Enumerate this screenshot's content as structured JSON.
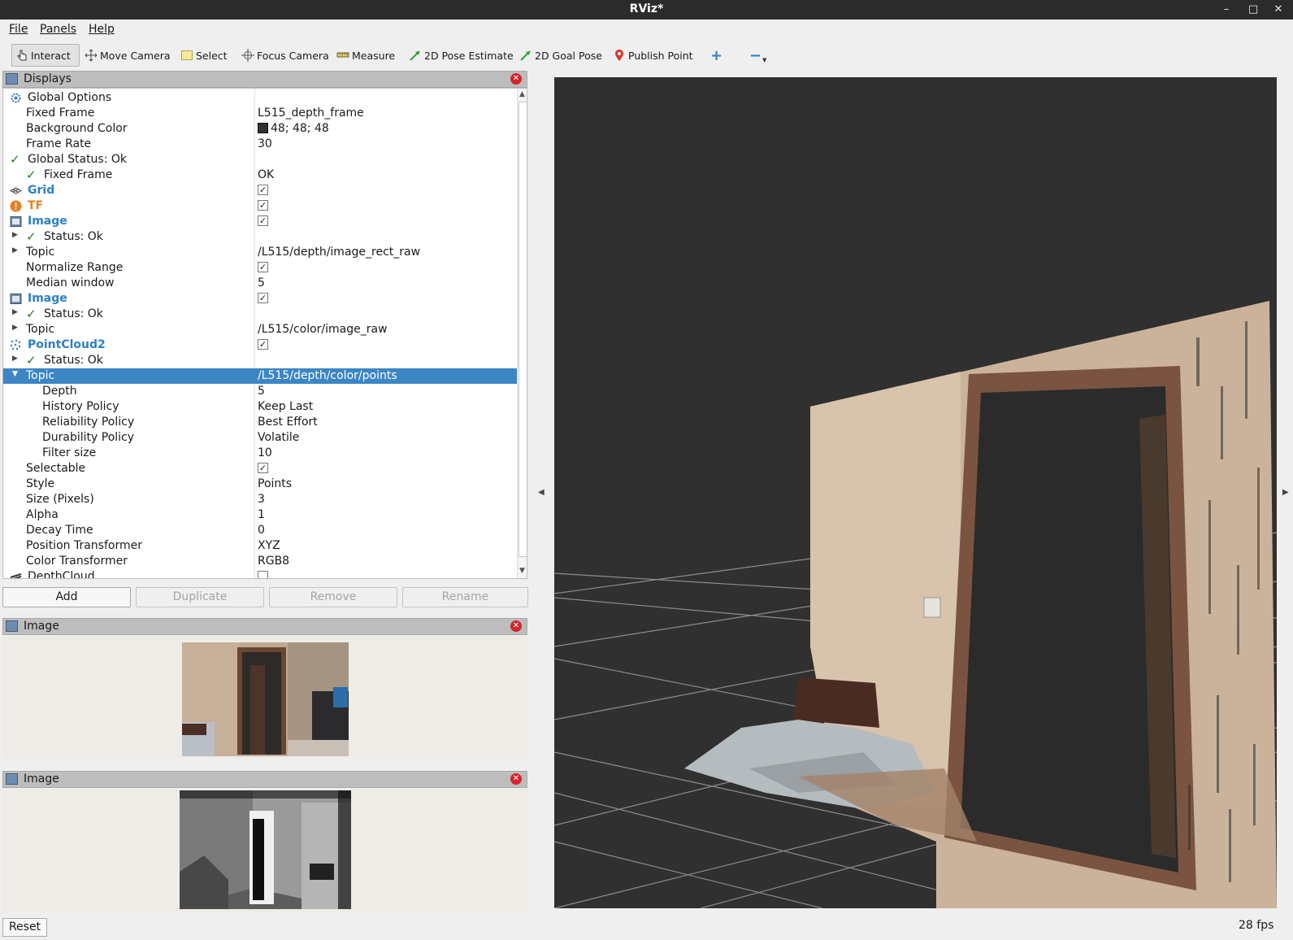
{
  "window": {
    "title": "RViz*",
    "controls": [
      "–",
      "□",
      "✕"
    ]
  },
  "menu": [
    "File",
    "Panels",
    "Help"
  ],
  "toolbar": {
    "interact": "Interact",
    "move_camera": "Move Camera",
    "select": "Select",
    "focus_camera": "Focus Camera",
    "measure": "Measure",
    "pose_estimate": "2D Pose Estimate",
    "goal_pose": "2D Goal Pose",
    "publish_point": "Publish Point",
    "add_tool": "+",
    "remove_tool": "−"
  },
  "displays": {
    "title": "Displays",
    "close": "✕",
    "rows": [
      {
        "label": "Global Options",
        "value": ""
      },
      {
        "label": "Fixed Frame",
        "value": "L515_depth_frame"
      },
      {
        "label": "Background Color",
        "value": "48; 48; 48"
      },
      {
        "label": "Frame Rate",
        "value": "30"
      },
      {
        "label": "Global Status: Ok",
        "value": ""
      },
      {
        "label": "Fixed Frame",
        "value": "OK"
      },
      {
        "label": "Grid",
        "value": "✓"
      },
      {
        "label": "TF",
        "value": "✓"
      },
      {
        "label": "Image",
        "value": "✓"
      },
      {
        "label": "Status: Ok",
        "value": ""
      },
      {
        "label": "Topic",
        "value": "/L515/depth/image_rect_raw"
      },
      {
        "label": "Normalize Range",
        "value": "✓"
      },
      {
        "label": "Median window",
        "value": "5"
      },
      {
        "label": "Image",
        "value": "✓"
      },
      {
        "label": "Status: Ok",
        "value": ""
      },
      {
        "label": "Topic",
        "value": "/L515/color/image_raw"
      },
      {
        "label": "PointCloud2",
        "value": "✓"
      },
      {
        "label": "Status: Ok",
        "value": ""
      },
      {
        "label": "Topic",
        "value": "/L515/depth/color/points"
      },
      {
        "label": "Depth",
        "value": "5"
      },
      {
        "label": "History Policy",
        "value": "Keep Last"
      },
      {
        "label": "Reliability Policy",
        "value": "Best Effort"
      },
      {
        "label": "Durability Policy",
        "value": "Volatile"
      },
      {
        "label": "Filter size",
        "value": "10"
      },
      {
        "label": "Selectable",
        "value": "✓"
      },
      {
        "label": "Style",
        "value": "Points"
      },
      {
        "label": "Size (Pixels)",
        "value": "3"
      },
      {
        "label": "Alpha",
        "value": "1"
      },
      {
        "label": "Decay Time",
        "value": "0"
      },
      {
        "label": "Position Transformer",
        "value": "XYZ"
      },
      {
        "label": "Color Transformer",
        "value": "RGB8"
      },
      {
        "label": "DepthCloud",
        "value": ""
      }
    ],
    "background_color_hex": "#303030"
  },
  "buttons": {
    "add": "Add",
    "duplicate": "Duplicate",
    "remove": "Remove",
    "rename": "Rename"
  },
  "image_panel_color": {
    "title": "Image",
    "close": "✕"
  },
  "image_panel_depth": {
    "title": "Image",
    "close": "✕"
  },
  "status": {
    "reset": "Reset",
    "fps": "28 fps"
  },
  "colors": {
    "selection": "#3c86c4",
    "plugin_name": "#2e7fc4",
    "warning": "#e67e22",
    "ok_check": "#1e7b1e",
    "viewport_bg": "#303030"
  }
}
